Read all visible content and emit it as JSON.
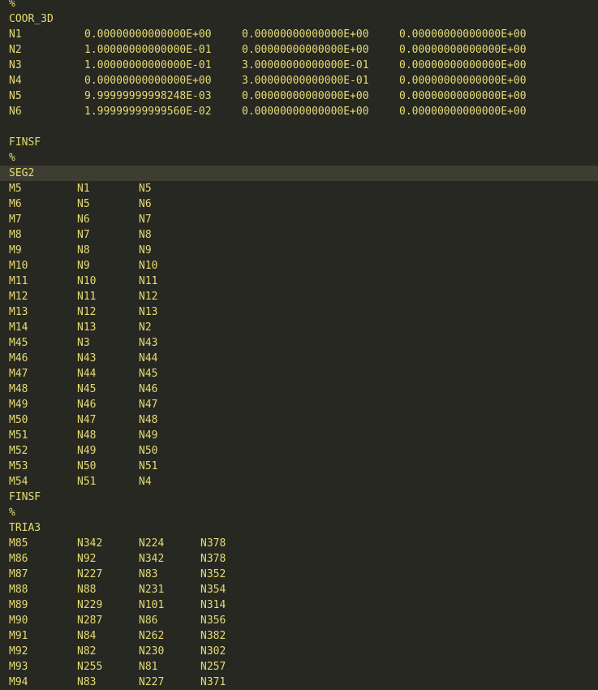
{
  "editor": {
    "lines": [
      {
        "cells": [
          "%"
        ]
      },
      {
        "cells": [
          "COOR_3D"
        ]
      },
      {
        "cells": [
          "N1",
          "0.00000000000000E+00",
          "0.00000000000000E+00",
          "0.00000000000000E+00"
        ]
      },
      {
        "cells": [
          "N2",
          "1.00000000000000E-01",
          "0.00000000000000E+00",
          "0.00000000000000E+00"
        ]
      },
      {
        "cells": [
          "N3",
          "1.00000000000000E-01",
          "3.00000000000000E-01",
          "0.00000000000000E+00"
        ]
      },
      {
        "cells": [
          "N4",
          "0.00000000000000E+00",
          "3.00000000000000E-01",
          "0.00000000000000E+00"
        ]
      },
      {
        "cells": [
          "N5",
          "9.99999999998248E-03",
          "0.00000000000000E+00",
          "0.00000000000000E+00"
        ]
      },
      {
        "cells": [
          "N6",
          "1.99999999999560E-02",
          "0.00000000000000E+00",
          "0.00000000000000E+00"
        ]
      },
      {
        "cells": []
      },
      {
        "cells": [
          "FINSF"
        ]
      },
      {
        "cells": [
          "%"
        ]
      },
      {
        "cells": [
          "SEG2"
        ],
        "current": true
      },
      {
        "cells": [
          "M5",
          "N1",
          "N5"
        ]
      },
      {
        "cells": [
          "M6",
          "N5",
          "N6"
        ]
      },
      {
        "cells": [
          "M7",
          "N6",
          "N7"
        ]
      },
      {
        "cells": [
          "M8",
          "N7",
          "N8"
        ]
      },
      {
        "cells": [
          "M9",
          "N8",
          "N9"
        ]
      },
      {
        "cells": [
          "M10",
          "N9",
          "N10"
        ]
      },
      {
        "cells": [
          "M11",
          "N10",
          "N11"
        ]
      },
      {
        "cells": [
          "M12",
          "N11",
          "N12"
        ]
      },
      {
        "cells": [
          "M13",
          "N12",
          "N13"
        ]
      },
      {
        "cells": [
          "M14",
          "N13",
          "N2"
        ]
      },
      {
        "cells": [
          "M45",
          "N3",
          "N43"
        ]
      },
      {
        "cells": [
          "M46",
          "N43",
          "N44"
        ]
      },
      {
        "cells": [
          "M47",
          "N44",
          "N45"
        ]
      },
      {
        "cells": [
          "M48",
          "N45",
          "N46"
        ]
      },
      {
        "cells": [
          "M49",
          "N46",
          "N47"
        ]
      },
      {
        "cells": [
          "M50",
          "N47",
          "N48"
        ]
      },
      {
        "cells": [
          "M51",
          "N48",
          "N49"
        ]
      },
      {
        "cells": [
          "M52",
          "N49",
          "N50"
        ]
      },
      {
        "cells": [
          "M53",
          "N50",
          "N51"
        ]
      },
      {
        "cells": [
          "M54",
          "N51",
          "N4"
        ]
      },
      {
        "cells": [
          "FINSF"
        ]
      },
      {
        "cells": [
          "%"
        ]
      },
      {
        "cells": [
          "TRIA3"
        ]
      },
      {
        "cells": [
          "M85",
          "N342",
          "N224",
          "N378"
        ]
      },
      {
        "cells": [
          "M86",
          "N92",
          "N342",
          "N378"
        ]
      },
      {
        "cells": [
          "M87",
          "N227",
          "N83",
          "N352"
        ]
      },
      {
        "cells": [
          "M88",
          "N88",
          "N231",
          "N354"
        ]
      },
      {
        "cells": [
          "M89",
          "N229",
          "N101",
          "N314"
        ]
      },
      {
        "cells": [
          "M90",
          "N287",
          "N86",
          "N356"
        ]
      },
      {
        "cells": [
          "M91",
          "N84",
          "N262",
          "N382"
        ]
      },
      {
        "cells": [
          "M92",
          "N82",
          "N230",
          "N302"
        ]
      },
      {
        "cells": [
          "M93",
          "N255",
          "N81",
          "N257"
        ]
      },
      {
        "cells": [
          "M94",
          "N83",
          "N227",
          "N371"
        ]
      }
    ]
  }
}
